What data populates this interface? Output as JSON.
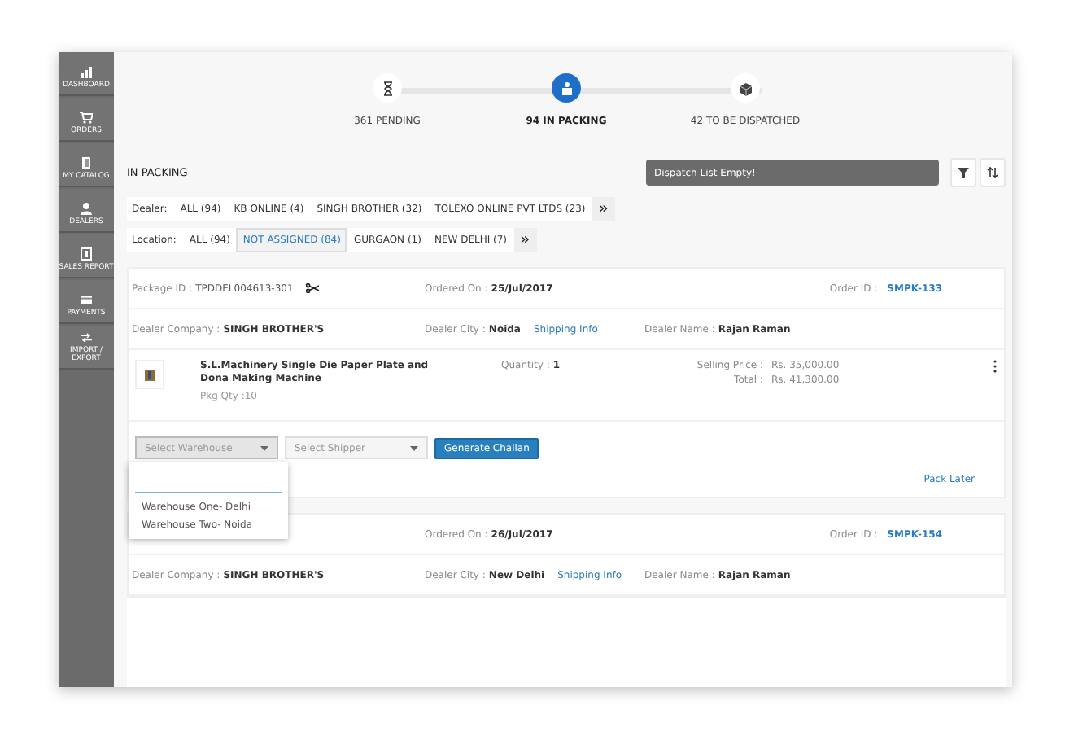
{
  "sidebar": {
    "items": [
      {
        "label": "DASHBOARD",
        "selected": false
      },
      {
        "label": "ORDERS",
        "selected": false
      },
      {
        "label": "MY CATALOG",
        "selected": false
      },
      {
        "label": "DEALERS",
        "selected": false
      },
      {
        "label": "SALES REPORT",
        "selected": false
      },
      {
        "label": "PAYMENTS",
        "selected": false
      },
      {
        "label": "IMPORT / EXPORT",
        "selected": false
      }
    ]
  },
  "steps": [
    {
      "label": "361 PENDING",
      "selected": false
    },
    {
      "label": "94 IN PACKING",
      "selected": true
    },
    {
      "label": "42 TO BE DISPATCHED",
      "selected": false
    }
  ],
  "header": {
    "title": "IN PACKING",
    "dispatch_status": "Dispatch List Empty!"
  },
  "filters": [
    {
      "label": "Dealer:",
      "options": [
        {
          "label": "ALL (94)",
          "selected": false
        },
        {
          "label": "KB ONLINE (4)",
          "selected": false
        },
        {
          "label": "SINGH BROTHER (32)",
          "selected": false
        },
        {
          "label": "TOLEXO ONLINE PVT LTDS (23)",
          "selected": false
        }
      ],
      "more": "»"
    },
    {
      "label": "Location:",
      "options": [
        {
          "label": "ALL (94)",
          "selected": false
        },
        {
          "label": "NOT ASSIGNED (84)",
          "selected": true
        },
        {
          "label": "GURGAON (1)",
          "selected": false
        },
        {
          "label": "NEW DELHI (7)",
          "selected": false
        }
      ],
      "more": "»"
    }
  ],
  "orders": [
    {
      "package_id_label": "Package ID :",
      "package_id": "TPDDEL004613-301",
      "ordered_on_label": "Ordered On :",
      "ordered_on": "25/Jul/2017",
      "order_id_label": "Order ID :",
      "order_id": "SMPK-133",
      "dealer_company_label": "Dealer Company :",
      "dealer_company": "SINGH BROTHER'S",
      "dealer_city_label": "Dealer City :",
      "dealer_city": "Noida",
      "shipping_info": "Shipping Info",
      "dealer_name_label": "Dealer Name :",
      "dealer_name": "Rajan Raman",
      "items": [
        {
          "name": "S.L.Machinery Single Die Paper Plate and Dona Making Machine",
          "pkg_qty": "Pkg Qty :10",
          "quantity_label": "Quantity :",
          "quantity": "1",
          "selling_price_label": "Selling Price :",
          "selling_price": "Rs. 35,000.00",
          "total_label": "Total :",
          "total": "Rs. 41,300.00"
        }
      ],
      "actions": {
        "warehouse_placeholder": "Select Warehouse",
        "shipper_placeholder": "Select Shipper",
        "generate": "Generate Challan",
        "pack_later": "Pack Later"
      }
    },
    {
      "ordered_on_label": "Ordered On :",
      "ordered_on": "26/Jul/2017",
      "order_id_label": "Order ID :",
      "order_id": "SMPK-154",
      "dealer_company_label": "Dealer Company :",
      "dealer_company": "SINGH BROTHER'S",
      "dealer_city_label": "Dealer City :",
      "dealer_city": "New Delhi",
      "shipping_info": "Shipping Info",
      "dealer_name_label": "Dealer Name :",
      "dealer_name": "Rajan Raman"
    }
  ],
  "warehouse_dropdown": {
    "options": [
      "Warehouse One- Delhi",
      "Warehouse Two- Noida"
    ]
  }
}
